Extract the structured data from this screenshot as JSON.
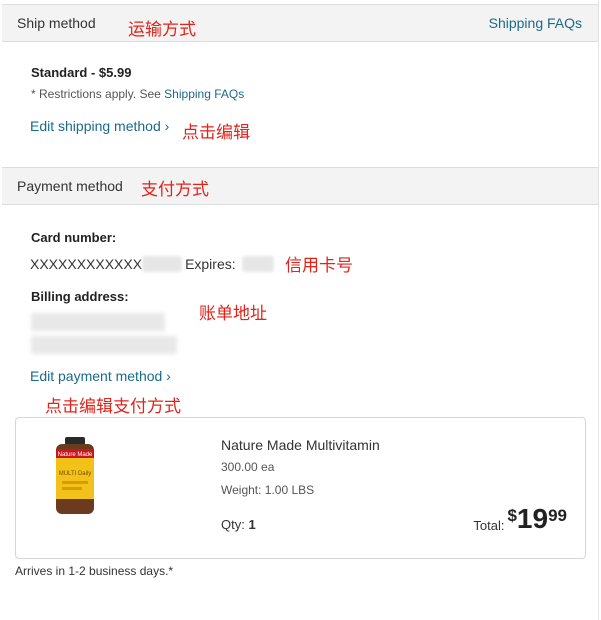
{
  "ship": {
    "header_title": "Ship method",
    "header_annotation": "运输方式",
    "faq_link": "Shipping FAQs",
    "method": "Standard - $5.99",
    "restrictions": "* Restrictions apply. See ",
    "restrictions_link": "Shipping FAQs",
    "edit_link": "Edit shipping method ›",
    "edit_annotation": "点击编辑"
  },
  "payment": {
    "header_title": "Payment method",
    "header_annotation": "支付方式",
    "card_label": "Card number:",
    "card_number": "XXXXXXXXXXXX",
    "expires_label": "Expires:",
    "card_annotation": "信用卡号",
    "billing_label": "Billing address:",
    "billing_annotation": "账单地址",
    "edit_link": "Edit payment method ›",
    "edit_annotation": "点击编辑支付方式"
  },
  "product": {
    "name": "Nature Made Multivitamin",
    "size": "300.00 ea",
    "weight": "Weight: 1.00 LBS",
    "qty_label": "Qty:",
    "qty_value": "1",
    "total_label": "Total:",
    "price_symbol": "$",
    "price_whole": "19",
    "price_fraction": "99",
    "image_label_text": "Nature Made",
    "image_sub_text": "MULTI Daily"
  },
  "arrives": "Arrives in 1-2 business days.*",
  "colors": {
    "link": "#1a6b8a",
    "annotation": "#e2231a",
    "header_bg": "#f3f3f3"
  }
}
